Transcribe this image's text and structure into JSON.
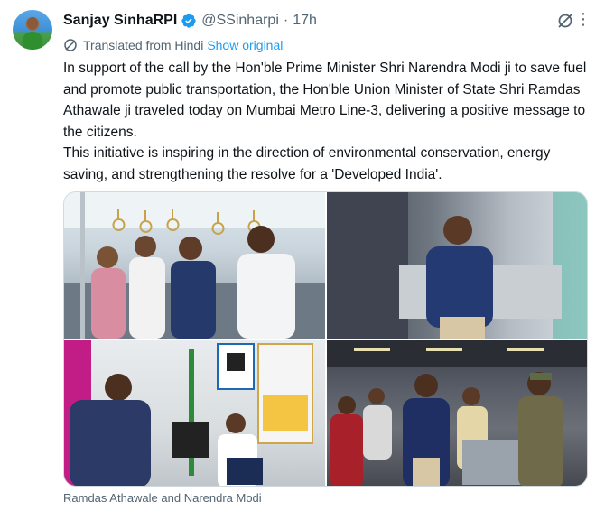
{
  "author": {
    "name": "Sanjay SinhaRPI",
    "handle": "@SSinharpi",
    "separator": "·",
    "time": "17h",
    "verified": true,
    "verified_color": "#1d9bf0"
  },
  "translation": {
    "label": "Translated from Hindi",
    "show_original": "Show original"
  },
  "tweet": {
    "paragraph1": "In support of the call by the Hon'ble Prime Minister Shri Narendra Modi ji to save fuel and promote public transportation, the Hon'ble Union Minister of State Shri Ramdas Athawale ji traveled today on Mumbai Metro Line-3, delivering a positive message to the citizens.",
    "paragraph2": "This initiative is inspiring in the direction of environmental conservation, energy saving, and strengthening the resolve for a 'Developed India'."
  },
  "media": {
    "caption": "Ramdas Athawale and Narendra Modi",
    "photos": [
      "metro-interior-standing-group",
      "minister-seated-metro",
      "metro-ticket-counter",
      "metro-station-walking-group"
    ]
  },
  "icons": {
    "avatar": "profile-avatar",
    "verified": "verified-badge-icon",
    "grok": "grok-icon",
    "more": "more-icon",
    "globe": "translate-icon"
  },
  "colors": {
    "text": "#0f1419",
    "muted": "#536471",
    "link": "#1d9bf0"
  }
}
